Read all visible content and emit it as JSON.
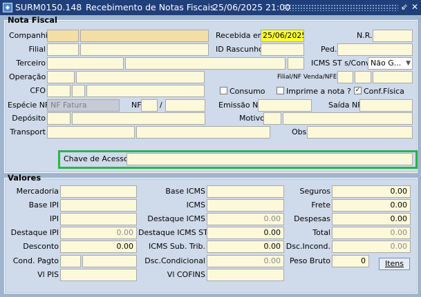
{
  "window": {
    "title_id": "SURM0150.148",
    "title": "Recebimento de Notas Fiscais",
    "datetime": "25/06/2025 21:00",
    "minimize_glyph": "⇙",
    "close_glyph": "✕"
  },
  "nota_fiscal": {
    "title": "Nota Fiscal",
    "companhia_label": "Companhia",
    "companhia_value": "",
    "recebida_label": "Recebida em",
    "recebida_value": "25/06/2025",
    "nr_label": "N.R.",
    "nr_value": "",
    "filial_label": "Filial",
    "filial_value": "",
    "id_rascunho_label": "ID Rascunho",
    "id_rascunho_value": "",
    "ped_label": "Ped.",
    "ped_value": "",
    "terceiro_label": "Terceiro",
    "terceiro_value": "",
    "icms_st_label": "ICMS ST s/Conv.",
    "icms_st_value": "Não G...",
    "operacao_label": "Operação",
    "operacao_value": "",
    "filial_nf_label": "Filial/NF Venda/NFE",
    "cfo_label": "CFO",
    "cfo_value": "",
    "consumo_label": "Consumo",
    "consumo_checked": false,
    "imprime_label": "Imprime a nota ?",
    "imprime_checked": false,
    "conf_fisica_label": "Conf.Física",
    "conf_fisica_checked": true,
    "especie_label": "Espécie NF",
    "especie_value": "NF Fatura",
    "nf_label": "NF",
    "nf_value": "",
    "nf_sep": "/",
    "emissao_label": "Emissão NF",
    "emissao_value": "",
    "saida_label": "Saída NF",
    "saida_value": "",
    "deposito_label": "Depósito",
    "deposito_value": "",
    "motivo_label": "Motivo",
    "motivo_value": "",
    "transport_label": "Transport",
    "transport_value": "",
    "obs_label": "Obs",
    "obs_value": "",
    "chave_label": "Chave de Acesso",
    "chave_value": ""
  },
  "valores": {
    "title": "Valores",
    "mercadoria_label": "Mercadoria",
    "mercadoria_value": "",
    "base_ipi_label": "Base IPI",
    "base_ipi_value": "",
    "ipi_label": "IPI",
    "ipi_value": "",
    "destaque_ipi_label": "Destaque IPI",
    "destaque_ipi_value": "0.00",
    "desconto_label": "Desconto",
    "desconto_value": "0.00",
    "cond_pagto_label": "Cond. Pagto",
    "cond_pagto_value": "",
    "vl_pis_label": "Vl PIS",
    "vl_pis_value": "",
    "base_icms_label": "Base ICMS",
    "base_icms_value": "",
    "icms_label": "ICMS",
    "icms_value": "",
    "destaque_icms_label": "Destaque ICMS",
    "destaque_icms_value": "0.00",
    "destaque_icms_st_label": "Destaque ICMS ST",
    "destaque_icms_st_value": "0.00",
    "icms_sub_trib_label": "ICMS Sub. Trib.",
    "icms_sub_trib_value": "0.00",
    "dsc_condicional_label": "Dsc.Condicional",
    "dsc_condicional_value": "0.00",
    "vl_cofins_label": "Vl COFINS",
    "vl_cofins_value": "",
    "seguros_label": "Seguros",
    "seguros_value": "0.00",
    "frete_label": "Frete",
    "frete_value": "0.00",
    "despesas_label": "Despesas",
    "despesas_value": "0.00",
    "total_label": "Total",
    "total_value": "0.00",
    "dsc_incond_label": "Dsc.Incond.",
    "dsc_incond_value": "0.00",
    "peso_bruto_label": "Peso Bruto",
    "peso_bruto_value": "0",
    "itens_button": "Itens"
  }
}
